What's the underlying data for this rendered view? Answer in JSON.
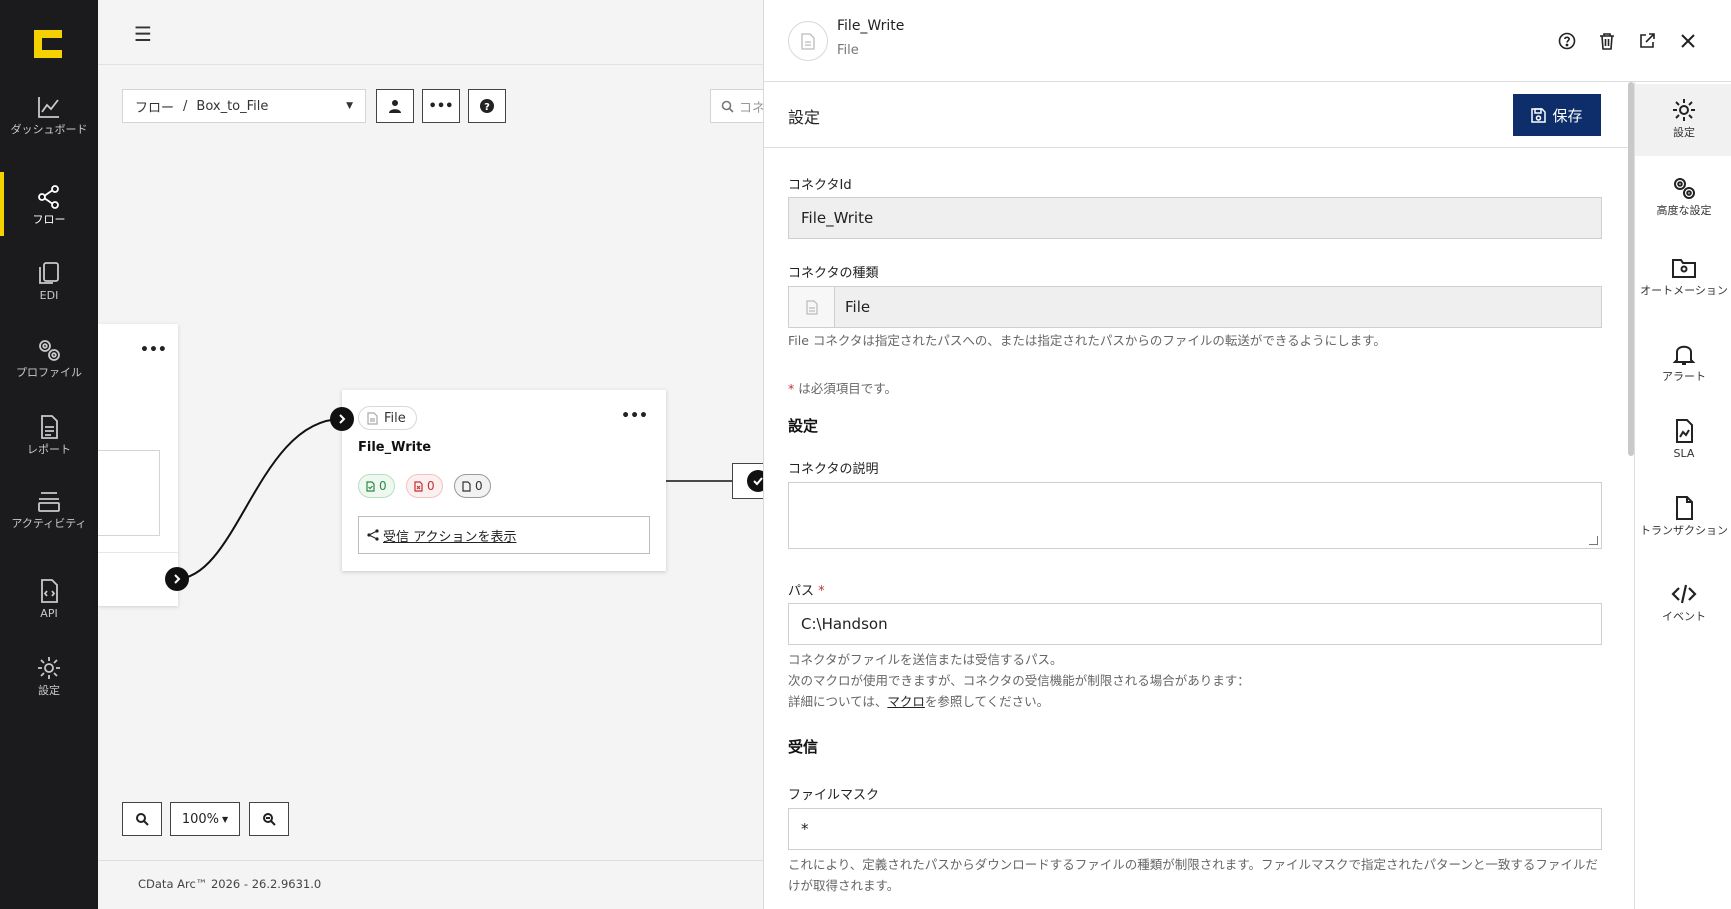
{
  "nav": {
    "items": [
      {
        "label": "ダッシュボード",
        "icon": "chart-line-icon"
      },
      {
        "label": "フロー",
        "icon": "share-nodes-icon"
      },
      {
        "label": "EDI",
        "icon": "copy-icon"
      },
      {
        "label": "プロファイル",
        "icon": "gears-icon"
      },
      {
        "label": "レポート",
        "icon": "report-icon"
      },
      {
        "label": "アクティビティ",
        "icon": "layers-icon"
      },
      {
        "label": "API",
        "icon": "code-file-icon"
      },
      {
        "label": "設定",
        "icon": "gear-icon"
      }
    ]
  },
  "canvas": {
    "breadcrumb_root": "フロー",
    "breadcrumb_sep": "/",
    "flow_name": "Box_to_File",
    "search_placeholder": "コネ",
    "node": {
      "type_label": "File",
      "name": "File_Write",
      "count_received": "0",
      "count_error": "0",
      "count_pending": "0",
      "action_label": "受信 アクションを表示"
    },
    "zoom_level": "100%",
    "footer_version": "CData Arc™ 2026 - 26.2.9631.0"
  },
  "panel": {
    "title": "File_Write",
    "subtitle": "File",
    "section_title": "設定",
    "save_label": "保存",
    "accent_color": "#0d2e6b",
    "fields": {
      "connector_id_label": "コネクタId",
      "connector_id_value": "File_Write",
      "connector_type_label": "コネクタの種類",
      "connector_type_value": "File",
      "connector_type_help": "File コネクタは指定されたパスへの、または指定されたパスからのファイルの転送ができるようにします。",
      "required_note_star": "*",
      "required_note": " は必須項目です。",
      "settings_heading": "設定",
      "description_label": "コネクタの説明",
      "path_label": "パス",
      "path_required": " *",
      "path_value": "C:\\Handson",
      "path_help_1": "コネクタがファイルを送信または受信するパス。",
      "path_help_2": "次のマクロが使用できますが、コネクタの受信機能が制限される場合があります：",
      "path_help_3_pre": "詳細については、",
      "path_help_3_link": "マクロ",
      "path_help_3_post": "を参照してください。",
      "receive_heading": "受信",
      "filemask_label": "ファイルマスク",
      "filemask_value": "*",
      "filemask_help": "これにより、定義されたパスからダウンロードするファイルの種類が制限されます。ファイルマスクで指定されたパターンと一致するファイルだけが取得されます。"
    },
    "rail": [
      {
        "label": "設定",
        "icon": "gear-icon"
      },
      {
        "label": "高度な設定",
        "icon": "gears-icon"
      },
      {
        "label": "オートメーション",
        "icon": "folder-gear-icon"
      },
      {
        "label": "アラート",
        "icon": "bell-icon"
      },
      {
        "label": "SLA",
        "icon": "sla-file-icon"
      },
      {
        "label": "トランザクション",
        "icon": "file-icon"
      },
      {
        "label": "イベント",
        "icon": "code-icon"
      }
    ]
  }
}
